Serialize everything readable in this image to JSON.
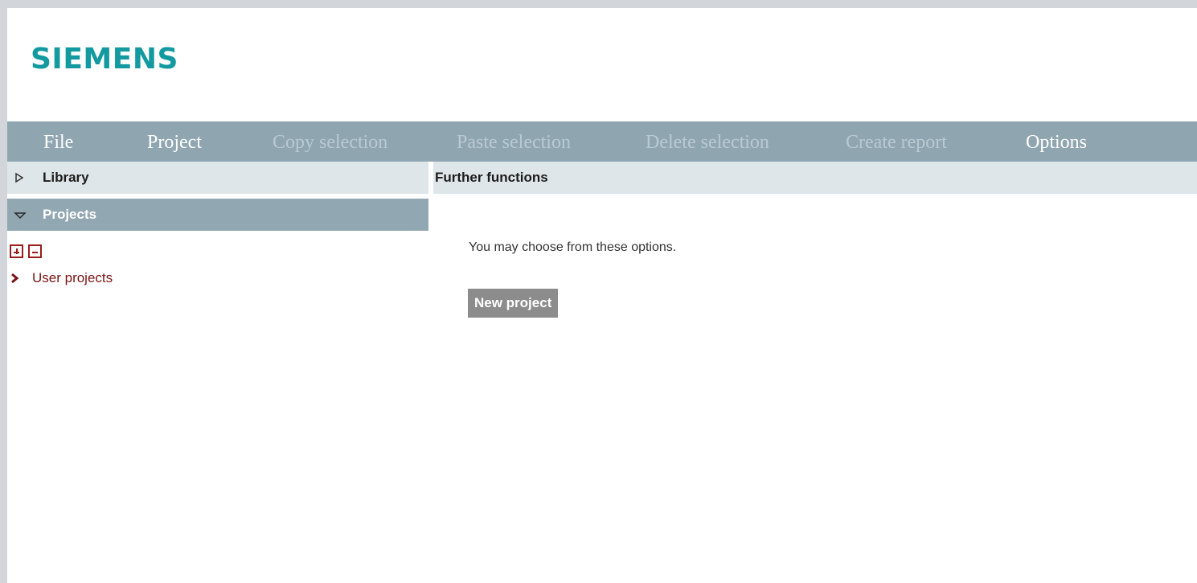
{
  "brand": {
    "logo_text": "SIEMENS",
    "logo_color": "#139aa0"
  },
  "menu": {
    "items": [
      {
        "label": "File",
        "enabled": true
      },
      {
        "label": "Project",
        "enabled": true
      },
      {
        "label": "Copy selection",
        "enabled": false
      },
      {
        "label": "Paste selection",
        "enabled": false
      },
      {
        "label": "Delete selection",
        "enabled": false
      },
      {
        "label": "Create report",
        "enabled": false
      },
      {
        "label": "Options",
        "enabled": true
      }
    ],
    "background_color": "#8fa6b1"
  },
  "sidebar": {
    "library": {
      "label": "Library",
      "expanded": false,
      "icon": "triangle-right-outline-icon"
    },
    "projects": {
      "label": "Projects",
      "expanded": true,
      "icon": "triangle-down-outline-icon"
    },
    "tree_controls": {
      "expand_icon": "plus-box-icon",
      "collapse_icon": "minus-box-icon"
    },
    "tree": [
      {
        "label": "User projects",
        "icon": "chevron-right-icon"
      }
    ]
  },
  "content": {
    "header": "Further functions",
    "intro": "You may choose from these options.",
    "new_project_label": "New project"
  },
  "colors": {
    "accent_dark_red": "#9b1c1c",
    "link_red": "#7a1414",
    "panel_light": "#dfe6e9",
    "button_gray": "#8c8c8c"
  }
}
